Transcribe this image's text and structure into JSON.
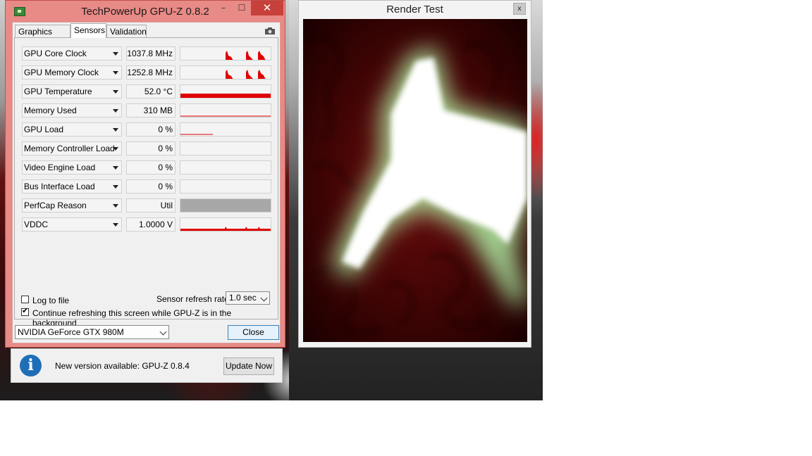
{
  "gpuz": {
    "title": "TechPowerUp GPU-Z 0.8.2",
    "window_buttons": {
      "minimize": "–",
      "maximize": "☐",
      "close": "✕"
    },
    "tabs": [
      {
        "label": "Graphics Card",
        "active": false
      },
      {
        "label": "Sensors",
        "active": true
      },
      {
        "label": "Validation",
        "active": false
      }
    ],
    "sensors": [
      {
        "name": "GPU Core Clock",
        "value": "1037.8 MHz"
      },
      {
        "name": "GPU Memory Clock",
        "value": "1252.8 MHz"
      },
      {
        "name": "GPU Temperature",
        "value": "52.0 °C"
      },
      {
        "name": "Memory Used",
        "value": "310 MB"
      },
      {
        "name": "GPU Load",
        "value": "0 %"
      },
      {
        "name": "Memory Controller Load",
        "value": "0 %"
      },
      {
        "name": "Video Engine Load",
        "value": "0 %"
      },
      {
        "name": "Bus Interface Load",
        "value": "0 %"
      },
      {
        "name": "PerfCap Reason",
        "value": "Util"
      },
      {
        "name": "VDDC",
        "value": "1.0000 V"
      }
    ],
    "log_to_file": {
      "label": "Log to file",
      "checked": false
    },
    "refresh_rate": {
      "label": "Sensor refresh rate:",
      "value": "1.0 sec"
    },
    "continue_refresh": {
      "label": "Continue refreshing this screen while GPU-Z is in the background",
      "checked": true
    },
    "card_select": "NVIDIA GeForce GTX 980M",
    "close_label": "Close"
  },
  "notification": {
    "icon": "info-icon",
    "message": "New version available: GPU-Z 0.8.4",
    "button": "Update Now"
  },
  "render_test": {
    "title": "Render Test",
    "close": "x"
  },
  "colors": {
    "gpuz_frame": "#e88a86",
    "graph_line": "#e00000",
    "close_button": "#c7403a",
    "info_icon": "#1f6fb8"
  }
}
